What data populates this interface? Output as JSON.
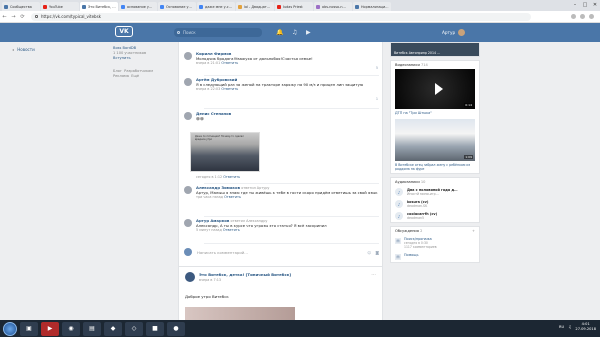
{
  "browser": {
    "tabs": [
      {
        "label": "Сообщества",
        "color": "#4a76a8"
      },
      {
        "label": "YouTube",
        "color": "#e62117"
      },
      {
        "label": "Это Витебск, де",
        "color": "#4a76a8",
        "active": true
      },
      {
        "label": "основание у…",
        "color": "#4285f4"
      },
      {
        "label": "Основание у…",
        "color": "#4285f4"
      },
      {
        "label": "даже мне у-с…",
        "color": "#4285f4"
      },
      {
        "label": "lol - Двадцат…",
        "color": "#e3a13b"
      },
      {
        "label": "Іudas Priest",
        "color": "#e62117"
      },
      {
        "label": "obs-nosso-n…",
        "color": "#9c6fc6"
      },
      {
        "label": "Нормализаци…",
        "color": "#4a76a8"
      }
    ],
    "url": "https://vk.com/typical_vitebsk",
    "window_controls": [
      "–",
      "□",
      "✕"
    ]
  },
  "vk_header": {
    "logo": "VK",
    "search_placeholder": "Поиск",
    "user_name": "Артур"
  },
  "left_nav": {
    "label": "Новости"
  },
  "left_column": {
    "title": "Boss BordDB",
    "subtitle": "1 100 участников",
    "link": "Вступить",
    "footer": [
      "Блог",
      "Разработчикам",
      "Реклама",
      "Ещё"
    ]
  },
  "comments": [
    {
      "name": "Кирилл Фирмов",
      "text": "Молодчик бродяга!Уважуха от дальнобоя!Счастья семье!",
      "date": "вчера в 21:01",
      "reply": "Ответить",
      "likes": "5"
    },
    {
      "name": "Артём Дубровский",
      "text": "Я в следующий раз за женой на тракторе заряжу на 90 м/з и прицеп лин защитую",
      "date": "вчера в 22:03",
      "reply": "Ответить",
      "likes": "1"
    },
    {
      "name": "Денис Степанов",
      "text": "😄😄",
      "date": "сегодня в 1:12",
      "reply": "Ответить",
      "likes": "",
      "photo_caption": "Даже по пятницам? Почему-то сделал вредное утро"
    },
    {
      "name": "Александр Зимаков",
      "answered": "ответил Артуру",
      "text": "Артур, Малыш я знаю где ты живёшь к тебе в гости скоро придём ответишь за свой язык",
      "date": "три часа назад",
      "reply": "Ответить",
      "likes": ""
    },
    {
      "name": "Артур Амарков",
      "answered": "ответил Александру",
      "text": "Александр, А ты в курсе что угрозы это статья? Я всё заскринил",
      "date": "5 минут назад",
      "reply": "Ответить",
      "likes": ""
    }
  ],
  "comment_input": {
    "placeholder": "Написать комментарий..."
  },
  "next_post": {
    "author": "Это Витебск, детка! [Типичный Витебск]",
    "date": "вчера в 7:13",
    "text": "Доброе утро Витебск"
  },
  "right_sidebar": {
    "ad_text": "Витебск Автоприпр 2014 ...",
    "videos_title": "Видеозаписи",
    "videos_count": "714",
    "video1_title": "ДТП на \"Три Штыка\"",
    "video1_duration": "0:14",
    "video2_title": "В Витебске отец забрал жену с ребёнком из роддома на фуре",
    "video2_duration": "1:09",
    "audio_title": "Аудиозаписи",
    "audio_count": "10",
    "audio": [
      {
        "title": "Два с половиной года д…",
        "artist": "Иностй мини-игр…"
      },
      {
        "title": "kosura (cv)",
        "artist": "deadman.SK"
      },
      {
        "title": "coolacarrfh (cv)",
        "artist": "deadman5"
      }
    ],
    "discussions_title": "Обсуждения",
    "discussions_count": "2",
    "discussions": [
      {
        "title": "Поиск/пропажа",
        "meta": "сегодня в 0:30\n1117 комментариев"
      },
      {
        "title": "Помощь",
        "meta": ""
      }
    ]
  },
  "taskbar": {
    "time": "4:01",
    "date": "27.09.2018",
    "lang": "RU"
  }
}
